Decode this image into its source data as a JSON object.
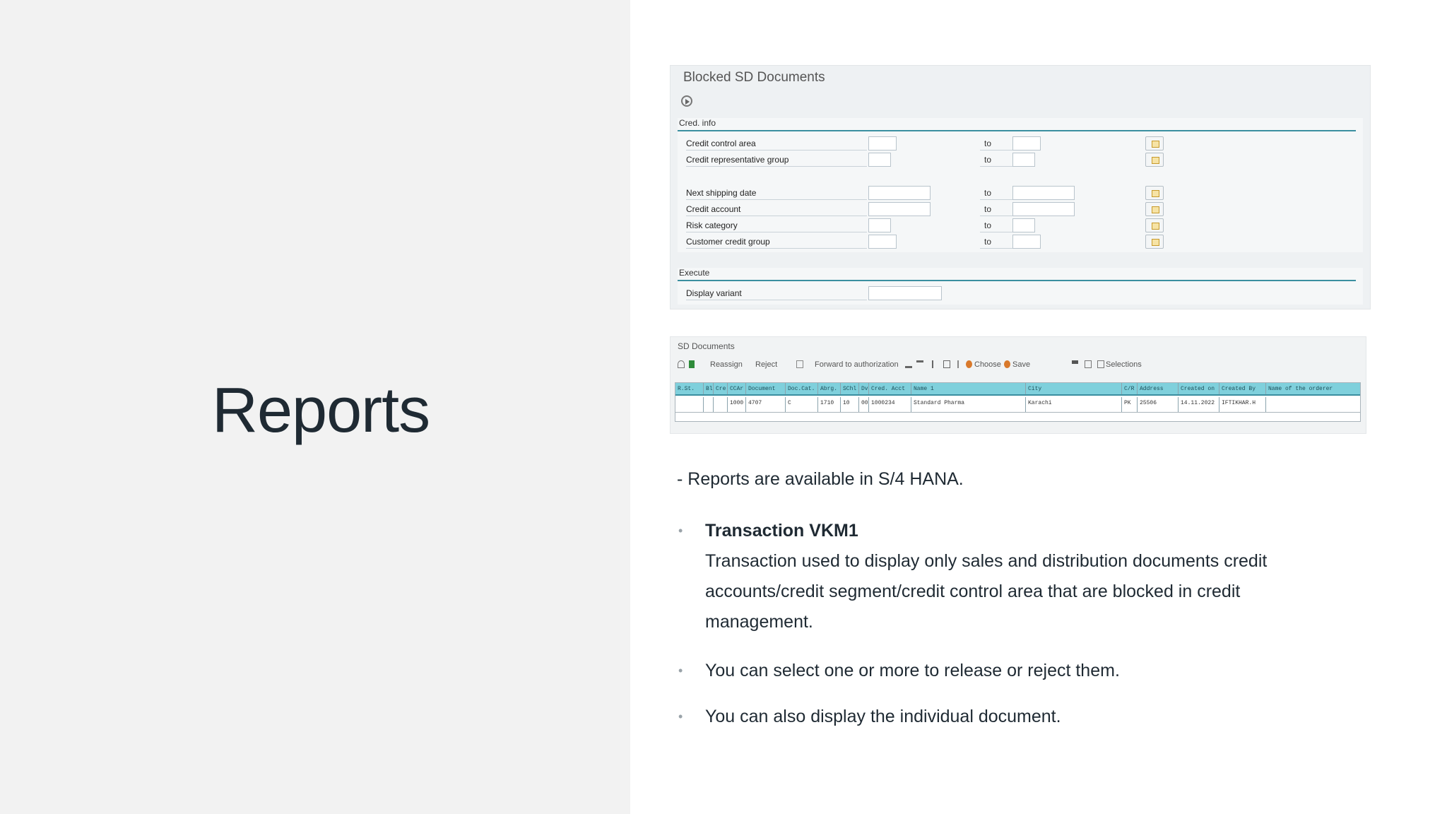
{
  "slide": {
    "title": "Reports"
  },
  "selection_screen": {
    "title": "Blocked SD Documents",
    "group_cred_info": "Cred. info",
    "rows": [
      {
        "label": "Credit control area",
        "to": "to"
      },
      {
        "label": "Credit representative group",
        "to": "to"
      },
      {
        "label": "Next shipping date",
        "to": "to"
      },
      {
        "label": "Credit account",
        "to": "to"
      },
      {
        "label": "Risk category",
        "to": "to"
      },
      {
        "label": "Customer credit group",
        "to": "to"
      }
    ],
    "group_execute": "Execute",
    "display_variant_label": "Display variant"
  },
  "alv": {
    "title": "SD Documents",
    "toolbar": {
      "reassign": "Reassign",
      "reject": "Reject",
      "forward": "Forward to authorization",
      "choose": "Choose",
      "save": "Save",
      "selections": "Selections"
    },
    "headers": [
      "R.St.",
      "Bl",
      "Cre",
      "CCAr",
      "Document",
      "Doc.Cat.",
      "Abrg.",
      "SChl",
      "Dv",
      "Cred. Acct",
      "Name 1",
      "City",
      "C/R",
      "Address",
      "Created on",
      "Created By",
      "Name of the orderer"
    ],
    "row": [
      "",
      "",
      "",
      "1000",
      "4707",
      "C",
      "1710",
      "10",
      "00",
      "1000234",
      "Standard Pharma",
      "Karachi",
      "PK",
      "25506",
      "14.11.2022",
      "IFTIKHAR.H",
      ""
    ]
  },
  "body": {
    "intro": "- Reports are available in S/4 HANA.",
    "bullets": [
      {
        "head": "Transaction VKM1",
        "text": "Transaction used to display only sales and distribution documents credit accounts/credit segment/credit control area that are blocked in credit management."
      },
      {
        "head": "",
        "text": "You can select one or more to release or reject them."
      },
      {
        "head": "",
        "text": "You can also display the individual document."
      }
    ],
    "bullet_char": "•"
  }
}
